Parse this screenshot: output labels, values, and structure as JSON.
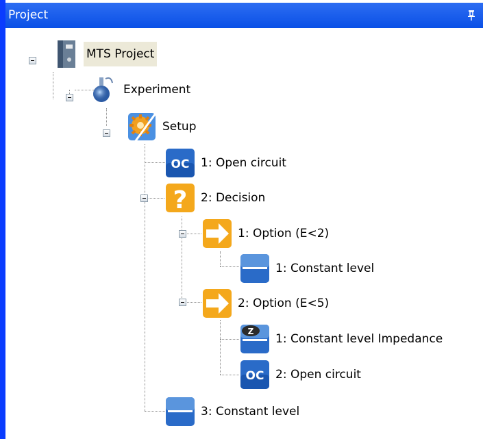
{
  "panel": {
    "title": "Project"
  },
  "tree": {
    "project": "MTS Project",
    "experiment": "Experiment",
    "setup": "Setup",
    "step1": "1: Open circuit",
    "decision": "2: Decision",
    "option1": "1: Option (E<2)",
    "option1_child1": "1: Constant level",
    "option2": "2: Option (E<5)",
    "option2_child1": "1: Constant level Impedance",
    "option2_child2": "2: Open circuit",
    "step3": "3: Constant level"
  },
  "icons": {
    "project": "binder-icon",
    "experiment": "flask-icon",
    "setup": "gear-icon",
    "open_circuit": "oc-icon",
    "decision": "question-icon",
    "option": "arrow-right-icon",
    "constant_level": "constant-level-icon",
    "impedance": "impedance-icon"
  }
}
